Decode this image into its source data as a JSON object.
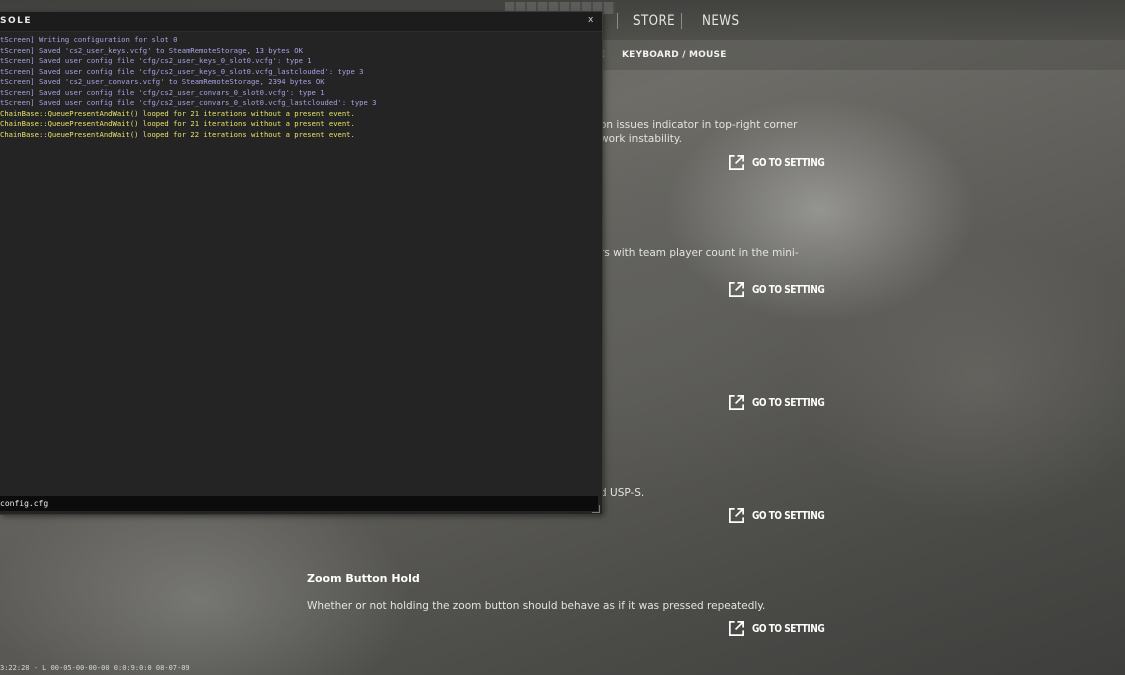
{
  "nav": {
    "items": [
      {
        "label": "STORE"
      },
      {
        "label": "NEWS"
      }
    ]
  },
  "subtabs": {
    "partial_tab": "E",
    "keyboard_mouse": "KEYBOARD / MOUSE"
  },
  "settings": [
    {
      "title": "",
      "desc_lines": [
        "on issues indicator in top-right corner",
        "work instability."
      ],
      "goto_label": "GO TO SETTING"
    },
    {
      "title": "",
      "desc_lines": [
        "rs with team player count in the mini-"
      ],
      "goto_label": "GO TO SETTING"
    },
    {
      "title": "",
      "desc_lines": [],
      "goto_label": "GO TO SETTING"
    },
    {
      "title": "",
      "desc_lines": [
        "d USP-S."
      ],
      "goto_label": "GO TO SETTING"
    },
    {
      "title": "Zoom Button Hold",
      "desc_lines": [
        "Whether or not holding the zoom button should behave as if it was pressed repeatedly."
      ],
      "goto_label": "GO TO SETTING"
    }
  ],
  "console": {
    "title": "SOLE",
    "close_label": "x",
    "log": [
      {
        "text": "tScreen] Writing configuration for slot 0",
        "level": "info"
      },
      {
        "text": "tScreen] Saved 'cs2_user_keys.vcfg' to SteamRemoteStorage, 13 bytes OK",
        "level": "info"
      },
      {
        "text": "tScreen] Saved user config file 'cfg/cs2_user_keys_0_slot0.vcfg': type 1",
        "level": "info"
      },
      {
        "text": "tScreen] Saved user config file 'cfg/cs2_user_keys_0_slot0.vcfg_lastclouded': type 3",
        "level": "info"
      },
      {
        "text": "tScreen] Saved 'cs2_user_convars.vcfg' to SteamRemoteStorage, 2394 bytes OK",
        "level": "info"
      },
      {
        "text": "tScreen] Saved user config file 'cfg/cs2_user_convars_0_slot0.vcfg': type 1",
        "level": "info"
      },
      {
        "text": "tScreen] Saved user config file 'cfg/cs2_user_convars_0_slot0.vcfg_lastclouded': type 3",
        "level": "info"
      },
      {
        "text": "ChainBase::QueuePresentAndWait() looped for 21 iterations without a present event.",
        "level": "warn"
      },
      {
        "text": "ChainBase::QueuePresentAndWait() looped for 21 iterations without a present event.",
        "level": "warn"
      },
      {
        "text": "ChainBase::QueuePresentAndWait() looped for 22 iterations without a present event.",
        "level": "warn"
      }
    ],
    "input_value": "config.cfg"
  },
  "status_bar": "3:22:28 - L 00-05-00-00-00 0:0:9:0:0 08-07-09",
  "colors": {
    "log_info": "#a7a2e6",
    "log_warn": "#e8e26a",
    "console_bg": "#242424"
  },
  "icons": {
    "goto": "external-link-icon"
  }
}
